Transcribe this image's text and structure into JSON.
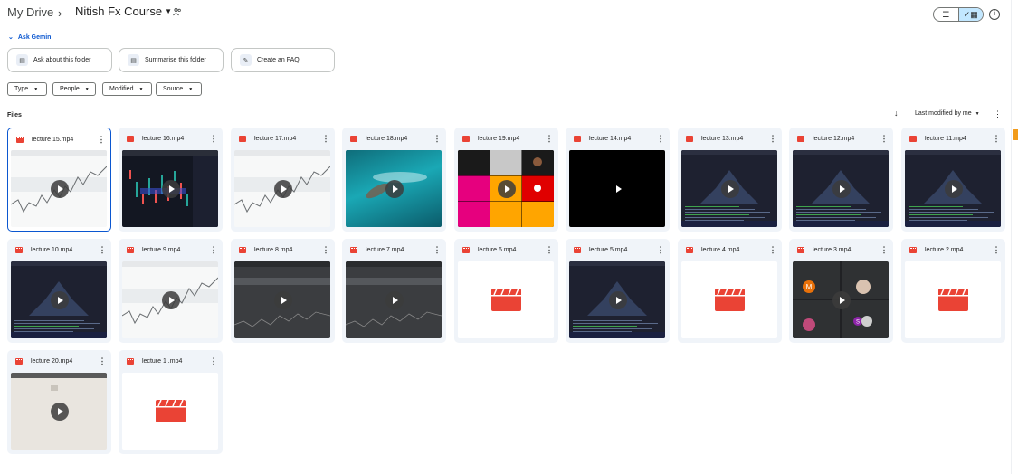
{
  "header": {
    "root": "My Drive",
    "separator": "›",
    "folder": "Nitish Fx Course",
    "view_list_icon": "list-icon",
    "view_grid_icon": "grid-icon",
    "info_icon": "info-icon"
  },
  "gemini": {
    "toggle": "Ask Gemini",
    "suggestions": [
      "Ask about this folder",
      "Summarise this folder",
      "Create an FAQ"
    ]
  },
  "filters": [
    "Type",
    "People",
    "Modified",
    "Source"
  ],
  "files_label": "Files",
  "sort": {
    "label": "Last modified by me"
  },
  "files": [
    {
      "name": "lecture 15.mp4",
      "thumb": "chart-light",
      "selected": true
    },
    {
      "name": "lecture 16.mp4",
      "thumb": "chart-dark"
    },
    {
      "name": "lecture 17.mp4",
      "thumb": "chart-light"
    },
    {
      "name": "lecture 18.mp4",
      "thumb": "water"
    },
    {
      "name": "lecture 19.mp4",
      "thumb": "grid"
    },
    {
      "name": "lecture 14.mp4",
      "thumb": "black"
    },
    {
      "name": "lecture 13.mp4",
      "thumb": "code"
    },
    {
      "name": "lecture 12.mp4",
      "thumb": "code"
    },
    {
      "name": "lecture 11.mp4",
      "thumb": "code"
    },
    {
      "name": "lecture 10.mp4",
      "thumb": "code"
    },
    {
      "name": "lecture 9.mp4",
      "thumb": "chart-light"
    },
    {
      "name": "lecture 8.mp4",
      "thumb": "gray"
    },
    {
      "name": "lecture 7.mp4",
      "thumb": "gray"
    },
    {
      "name": "lecture 6.mp4",
      "thumb": "blank"
    },
    {
      "name": "lecture 5.mp4",
      "thumb": "code"
    },
    {
      "name": "lecture 4.mp4",
      "thumb": "blank"
    },
    {
      "name": "lecture 3.mp4",
      "thumb": "meet"
    },
    {
      "name": "lecture 2.mp4",
      "thumb": "blank"
    },
    {
      "name": "lecture 20.mp4",
      "thumb": "beige"
    },
    {
      "name": "lecture 1 .mp4",
      "thumb": "blank"
    }
  ],
  "meet": {
    "avatar_m": "M",
    "avatar_s": "S"
  },
  "colors": {
    "accent": "#0b57d0",
    "video_red": "#ea4335",
    "card_bg": "#f0f4f9"
  }
}
